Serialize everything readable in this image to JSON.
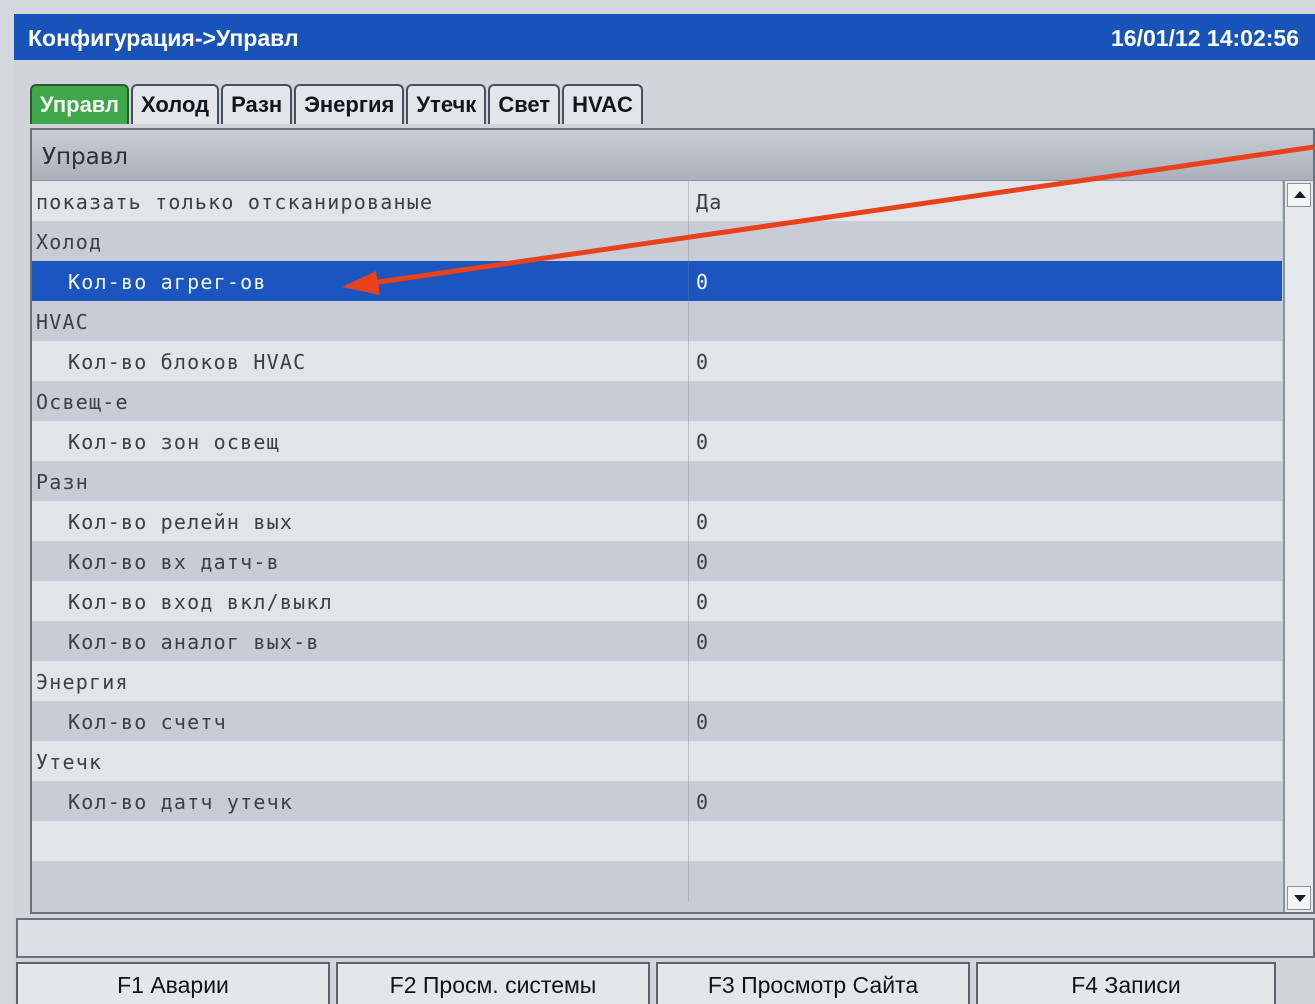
{
  "header": {
    "title": "Конфигурация->Управл",
    "datetime": "16/01/12 14:02:56"
  },
  "tabs": [
    {
      "label": "Управл",
      "active": true
    },
    {
      "label": "Холод",
      "active": false
    },
    {
      "label": "Разн",
      "active": false
    },
    {
      "label": "Энергия",
      "active": false
    },
    {
      "label": "Утечк",
      "active": false
    },
    {
      "label": "Свет",
      "active": false
    },
    {
      "label": "HVAC",
      "active": false
    }
  ],
  "panel": {
    "title": "Управл"
  },
  "rows": [
    {
      "label": "показать только отсканированые",
      "value": "Да",
      "indent": false
    },
    {
      "label": "Холод",
      "value": "",
      "indent": false
    },
    {
      "label": "Кол-во агрег-ов",
      "value": "0",
      "indent": true,
      "selected": true
    },
    {
      "label": "HVAC",
      "value": "",
      "indent": false
    },
    {
      "label": "Кол-во блоков HVAC",
      "value": "0",
      "indent": true
    },
    {
      "label": "Освещ-е",
      "value": "",
      "indent": false
    },
    {
      "label": "Кол-во зон освещ",
      "value": "0",
      "indent": true
    },
    {
      "label": "Разн",
      "value": "",
      "indent": false
    },
    {
      "label": "Кол-во релейн вых",
      "value": "0",
      "indent": true
    },
    {
      "label": "Кол-во вх датч-в",
      "value": "0",
      "indent": true
    },
    {
      "label": "Кол-во вход вкл/выкл",
      "value": "0",
      "indent": true
    },
    {
      "label": "Кол-во аналог вых-в",
      "value": "0",
      "indent": true
    },
    {
      "label": "Энергия",
      "value": "",
      "indent": false
    },
    {
      "label": "Кол-во счетч",
      "value": "0",
      "indent": true
    },
    {
      "label": "Утечк",
      "value": "",
      "indent": false
    },
    {
      "label": "Кол-во датч утечк",
      "value": "0",
      "indent": true
    },
    {
      "label": "",
      "value": "",
      "indent": false
    },
    {
      "label": "",
      "value": "",
      "indent": false
    }
  ],
  "status": {
    "text": ""
  },
  "function_keys": [
    {
      "label": "F1 Аварии"
    },
    {
      "label": "F2 Просм. системы"
    },
    {
      "label": "F3 Просмотр Сайта"
    },
    {
      "label": "F4 Записи"
    }
  ],
  "colors": {
    "titlebar": "#1753b8",
    "selection": "#1b55c0",
    "active_tab": "#3fa64a",
    "annotation_arrow": "#e8411c"
  }
}
